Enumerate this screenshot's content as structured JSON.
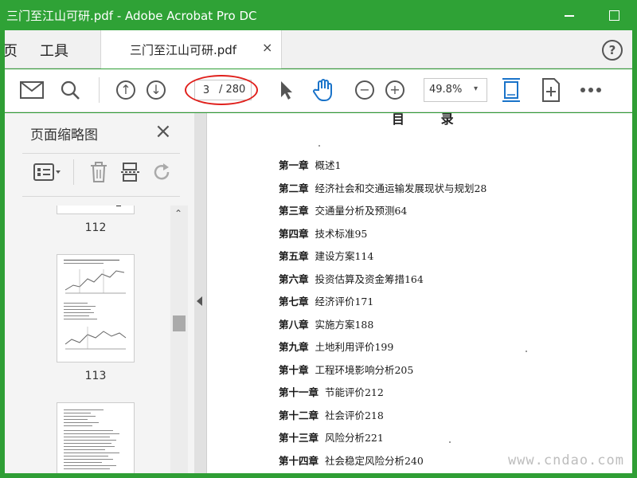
{
  "window": {
    "title": "三门至江山可研.pdf - Adobe Acrobat Pro DC"
  },
  "menu": {
    "items": [
      {
        "label": "页"
      },
      {
        "label": "工具"
      }
    ],
    "tab": {
      "label": "三门至江山可研.pdf",
      "close": "×"
    },
    "help_icon": "?"
  },
  "toolbar": {
    "icons": [
      "mail-icon",
      "search-icon",
      "arrow-up-icon",
      "arrow-down-icon",
      "cursor-icon",
      "hand-icon",
      "zoom-out-icon",
      "zoom-in-icon",
      "fit-page-icon",
      "page-tools-icon",
      "more-icon"
    ],
    "page_current": "3",
    "page_total": "/ 280",
    "zoom": "49.8%",
    "zoom_arrow": "▾",
    "highlight_color": "#e0201c",
    "active_color": "#1a73c9"
  },
  "panel": {
    "title": "页面缩略图",
    "close": "×",
    "thumbnails": [
      {
        "label": "112"
      },
      {
        "label": "113"
      }
    ]
  },
  "document": {
    "toc_title": "目 录",
    "toc": [
      {
        "chapter": "第一章",
        "title": "概述",
        "page": "1"
      },
      {
        "chapter": "第二章",
        "title": "经济社会和交通运输发展现状与规划",
        "page": "28"
      },
      {
        "chapter": "第三章",
        "title": "交通量分析及预测",
        "page": "64"
      },
      {
        "chapter": "第四章",
        "title": "技术标准",
        "page": "95"
      },
      {
        "chapter": "第五章",
        "title": "建设方案",
        "page": "114"
      },
      {
        "chapter": "第六章",
        "title": "投资估算及资金筹措",
        "page": "164"
      },
      {
        "chapter": "第七章",
        "title": "经济评价",
        "page": "171"
      },
      {
        "chapter": "第八章",
        "title": "实施方案",
        "page": "188"
      },
      {
        "chapter": "第九章",
        "title": "土地利用评价",
        "page": "199"
      },
      {
        "chapter": "第十章",
        "title": "工程环境影响分析",
        "page": "205"
      },
      {
        "chapter": "第十一章",
        "title": "节能评价",
        "page": "212"
      },
      {
        "chapter": "第十二章",
        "title": "社会评价",
        "page": "218"
      },
      {
        "chapter": "第十三章",
        "title": "风险分析",
        "page": "221"
      },
      {
        "chapter": "第十四章",
        "title": "社会稳定风险分析",
        "page": "240"
      }
    ],
    "watermark": "www.cndao.com"
  }
}
